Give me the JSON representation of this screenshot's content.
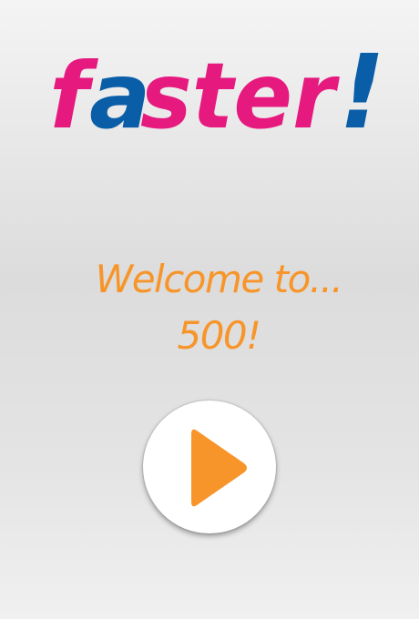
{
  "logo": {
    "part1": "f",
    "part2": "a",
    "part3": "ster",
    "part4": "!",
    "colors": {
      "magenta": "#e6197f",
      "blue": "#0a5ea8"
    }
  },
  "welcome": {
    "line1": "Welcome to...",
    "line2": "500!"
  },
  "play_button": {
    "icon": "play-icon",
    "background": "#ffffff",
    "icon_color": "#f7952a"
  }
}
